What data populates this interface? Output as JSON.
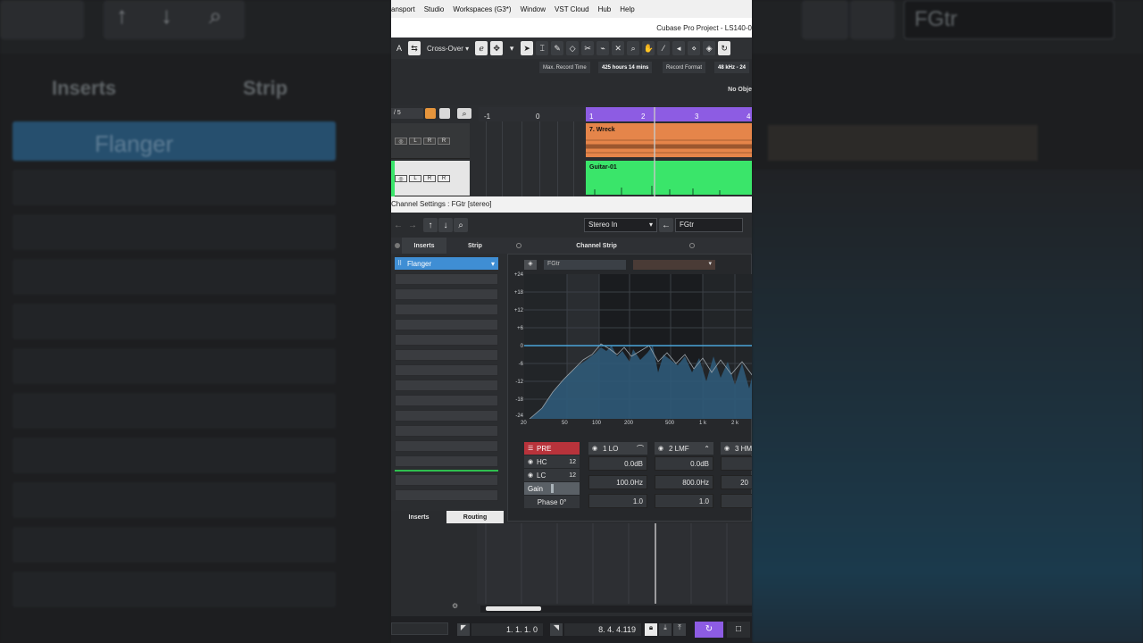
{
  "left_ghost": {
    "inserts": "Inserts",
    "strip": "Strip",
    "slot_name": "Flanger"
  },
  "right_ghost": {
    "channel": "FGtr"
  },
  "menu": {
    "items": [
      "ansport",
      "Studio",
      "Workspaces (G3*)",
      "Window",
      "VST Cloud",
      "Hub",
      "Help"
    ]
  },
  "window_title": "Cubase Pro Project - LS140-0",
  "toolbar": {
    "mode_a": "A",
    "preset": "Cross-Over",
    "preset_caret": "▾",
    "snap_caret": "▾"
  },
  "info": {
    "max_record_time_label": "Max. Record Time",
    "max_record_time_value": "425 hours 14 mins",
    "record_format_label": "Record Format",
    "record_format_value": "48 kHz - 24",
    "no_object": "No Obje"
  },
  "project": {
    "track_count": "/ 5",
    "ruler": [
      "-1",
      "0",
      "1",
      "2",
      "3",
      "4"
    ],
    "tracks": [
      {
        "clip": "7. Wreck",
        "color": "#e5854a"
      },
      {
        "clip": "Guitar-01",
        "color": "#3ae56a"
      }
    ],
    "track_buttons": [
      "L",
      "R",
      "R"
    ]
  },
  "channel_settings": {
    "title": "Channel Settings : FGtr [stereo]",
    "input": "Stereo In",
    "channel_name": "FGtr"
  },
  "tabs": {
    "inserts": "Inserts",
    "strip": "Strip",
    "channel_strip": "Channel Strip"
  },
  "inserts": {
    "slot1": "Flanger",
    "caret": "▾"
  },
  "bottom_tabs": {
    "inserts": "Inserts",
    "routing": "Routing"
  },
  "eq": {
    "name_field": "FGtr",
    "y_labels": [
      "+24",
      "+18",
      "+12",
      "+6",
      "0",
      "-6",
      "-12",
      "-18",
      "-24"
    ],
    "x_labels": [
      "20",
      "50",
      "100",
      "200",
      "500",
      "1 k",
      "2 k"
    ],
    "pre_label": "PRE",
    "hc_label": "HC",
    "lc_label": "LC",
    "filter_slope": "12",
    "gain_label": "Gain",
    "phase_label": "Phase 0°",
    "bands": [
      {
        "name": "1 LO",
        "gain": "0.0dB",
        "freq": "100.0Hz",
        "q": "1.0"
      },
      {
        "name": "2 LMF",
        "gain": "0.0dB",
        "freq": "800.0Hz",
        "q": "1.0"
      },
      {
        "name": "3 HM",
        "gain": "",
        "freq": "20",
        "q": ""
      }
    ],
    "accent": "#4aa3d8"
  },
  "transport": {
    "left_locator": "1. 1. 1.  0",
    "right_locator": "8. 4. 4.119"
  }
}
